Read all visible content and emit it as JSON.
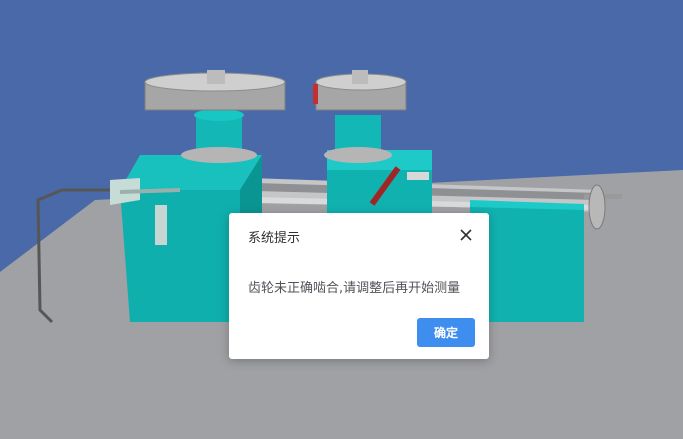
{
  "dialog": {
    "title": "系统提示",
    "message": "齿轮未正确啮合,请调整后再开始测量",
    "confirm_label": "确定",
    "close_icon": "close-icon"
  },
  "colors": {
    "background": "#4a69a8",
    "floor": "#9fa0a3",
    "machine_body": "#10b2b0",
    "gear": "#9c9c9c",
    "confirm_button": "#3e8ef0"
  }
}
